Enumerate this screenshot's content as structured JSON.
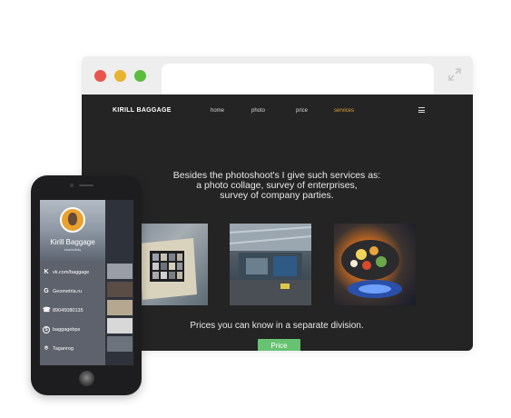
{
  "site": {
    "brand": "KIRILL BAGGAGE",
    "nav": [
      {
        "label": "home",
        "active": false
      },
      {
        "label": "photo",
        "active": false
      },
      {
        "label": "price",
        "active": false
      },
      {
        "label": "services",
        "active": true
      }
    ],
    "headline": [
      "Besides  the photoshoot's I give such services as:",
      "a photo collage, survey of enterprises,",
      "survey of company parties."
    ],
    "subline": "Prices you can know in a separate division.",
    "price_button": "Price",
    "pager": {
      "count": 3,
      "active_index": 2
    },
    "colors": {
      "background": "#242424",
      "accent": "#e0a43a",
      "button": "#67c272"
    }
  },
  "browser_chrome": {
    "controls": [
      "close",
      "minimize",
      "maximize"
    ],
    "expand_icon": "expand-icon"
  },
  "phone": {
    "name": "Kirill Baggage",
    "role": "sharkdbdy",
    "contacts": [
      {
        "icon": "vk-icon",
        "text": "vk.com/baggage"
      },
      {
        "icon": "geometria-icon",
        "text": "Geometria.ru"
      },
      {
        "icon": "phone-icon",
        "text": "89045080135"
      },
      {
        "icon": "skype-icon",
        "text": "baggagebps"
      },
      {
        "icon": "location-icon",
        "text": "Taganrog"
      }
    ]
  }
}
